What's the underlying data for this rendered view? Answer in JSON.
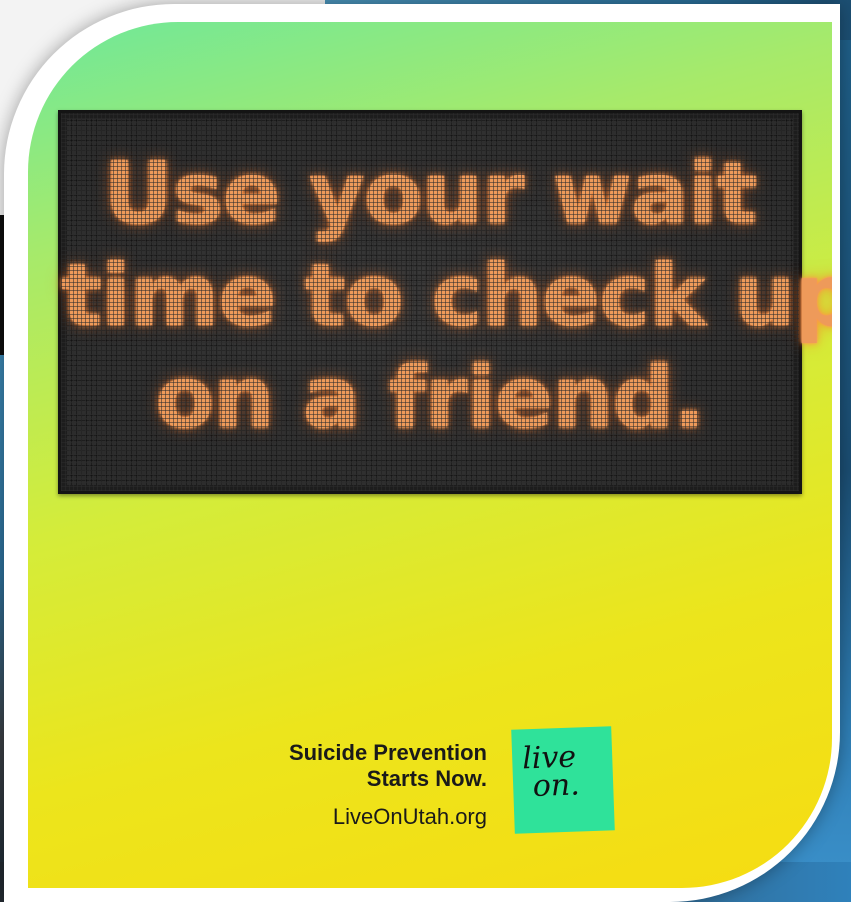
{
  "sign": {
    "lines": [
      "Use your wait",
      "time to check up",
      "on a friend."
    ]
  },
  "tagline": {
    "line1": "Suicide Prevention",
    "line2": "Starts Now."
  },
  "website": "LiveOnUtah.org",
  "logo": {
    "line1": "live",
    "line2": " on."
  },
  "colors": {
    "gradient_top": "#6fe89a",
    "gradient_bottom": "#f6dc12",
    "led_text": "#ee9a5a",
    "logo_bg": "#2fe29a"
  }
}
